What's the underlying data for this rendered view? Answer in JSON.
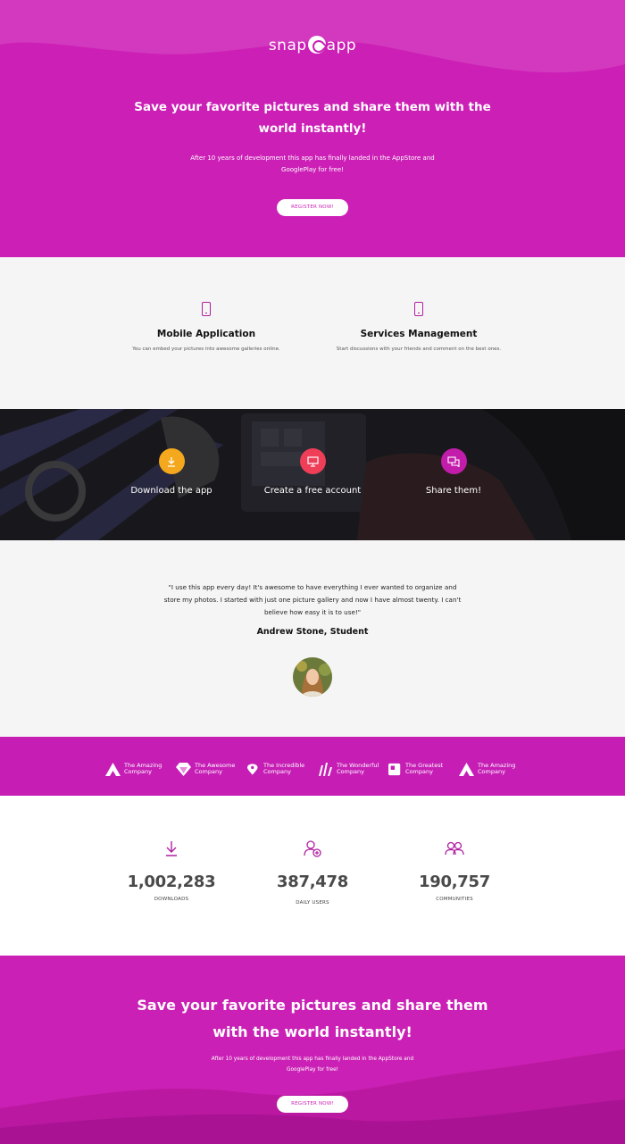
{
  "brand": {
    "left": "snap",
    "right": "app",
    "logo_icon": "camera-swirl-icon"
  },
  "hero": {
    "title": "Save your favorite pictures and share them with the world instantly!",
    "subtitle": "After 10 years of development this app has finally landed in the AppStore and GooglePlay for free!",
    "cta_label": "REGISTER NOW!"
  },
  "features": [
    {
      "icon": "smartphone-icon",
      "title": "Mobile Application",
      "text": "You can embed your pictures into awesome galleries online."
    },
    {
      "icon": "smartphone-icon",
      "title": "Services Management",
      "text": "Start discussions with your friends and comment on the best ones."
    }
  ],
  "steps": [
    {
      "icon": "download-icon",
      "label": "Download the app",
      "color": "#f4a81d"
    },
    {
      "icon": "monitor-icon",
      "label": "Create a free account",
      "color": "#ee3e58"
    },
    {
      "icon": "chat-bubbles-icon",
      "label": "Share them!",
      "color": "#c21cab"
    }
  ],
  "testimonial": {
    "quote": "\"I use this app every day! It's awesome to have everything I ever wanted to organize and store my photos. I started with just one picture gallery and now I have almost twenty. I can't believe how easy it is to use!\"",
    "author": "Andrew Stone, Student"
  },
  "companies": [
    {
      "icon": "triangle-mountain-icon",
      "line1": "The Amazing",
      "line2": "Company"
    },
    {
      "icon": "diamond-icon",
      "line1": "The Awesome",
      "line2": "Company"
    },
    {
      "icon": "location-pin-icon",
      "line1": "The Incredible",
      "line2": "Company"
    },
    {
      "icon": "bars-wave-icon",
      "line1": "The Wonderful",
      "line2": "Company"
    },
    {
      "icon": "square-badge-icon",
      "line1": "The Greatest",
      "line2": "Company"
    },
    {
      "icon": "triangle-mountain-icon",
      "line1": "The Amazing",
      "line2": "Company"
    }
  ],
  "stats": [
    {
      "icon": "download-icon",
      "value": "1,002,283",
      "label": "DOWNLOADS"
    },
    {
      "icon": "user-add-icon",
      "value": "387,478",
      "label": "DAILY USERS"
    },
    {
      "icon": "users-icon",
      "value": "190,757",
      "label": "COMMUNITIES"
    }
  ],
  "footer_cta": {
    "title": "Save your favorite pictures and share them with the world instantly!",
    "subtitle": "After 10 years of development this app has finally landed in the AppStore and GooglePlay for free!",
    "cta_label": "REGISTER NOW!"
  },
  "colors": {
    "brand_magenta": "#cc1fb6",
    "light_bg": "#f5f5f5",
    "dark_bg": "#1c1c22"
  }
}
